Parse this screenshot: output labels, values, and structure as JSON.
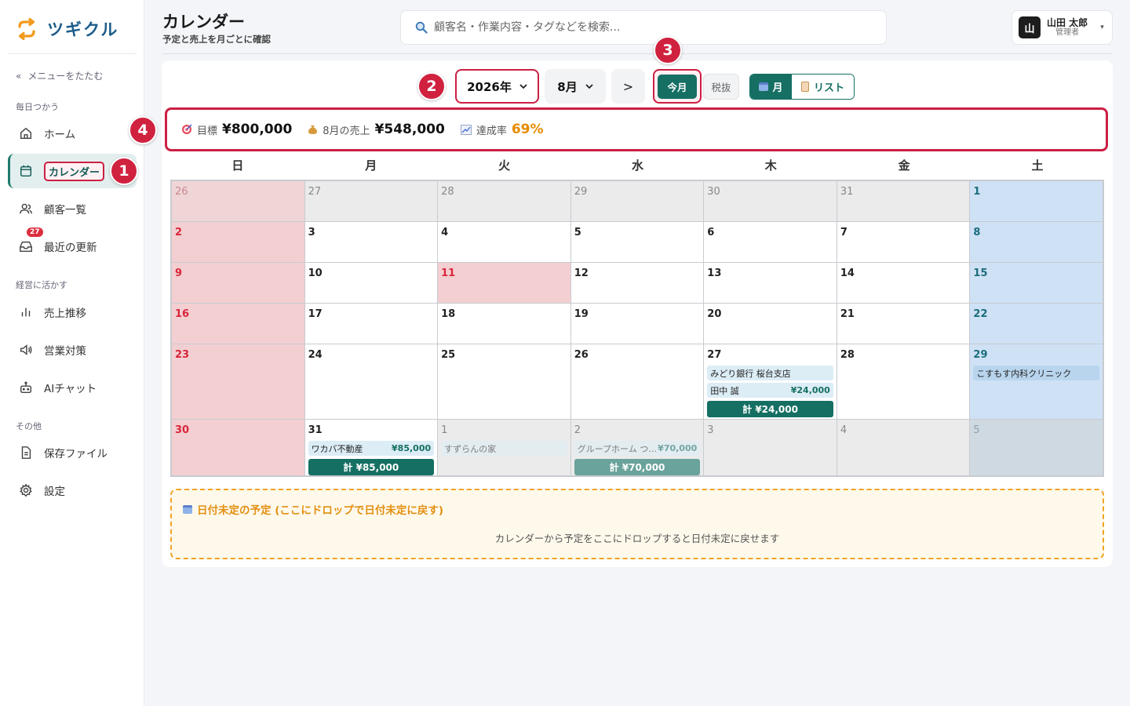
{
  "app": {
    "name": "ツギクル"
  },
  "sidebar": {
    "collapse_label": "メニューをたたむ",
    "collapse_icon": "«",
    "sections": [
      {
        "label": "毎日つかう"
      },
      {
        "label": "経営に活かす"
      },
      {
        "label": "その他"
      }
    ],
    "items": [
      {
        "label": "ホーム",
        "icon": "home-icon"
      },
      {
        "label": "カレンダー",
        "icon": "calendar-icon",
        "active": true
      },
      {
        "label": "顧客一覧",
        "icon": "users-icon"
      },
      {
        "label": "最近の更新",
        "icon": "inbox-icon",
        "badge": "27"
      },
      {
        "label": "売上推移",
        "icon": "bar-chart-icon"
      },
      {
        "label": "営業対策",
        "icon": "megaphone-icon"
      },
      {
        "label": "AIチャット",
        "icon": "robot-icon"
      },
      {
        "label": "保存ファイル",
        "icon": "file-icon"
      },
      {
        "label": "設定",
        "icon": "gear-icon"
      }
    ]
  },
  "header": {
    "title": "カレンダー",
    "subtitle": "予定と売上を月ごとに確認",
    "search_placeholder": "顧客名・作業内容・タグなどを検索...",
    "user_name": "山田 太郎",
    "user_role": "管理者",
    "user_avatar": "山"
  },
  "controls": {
    "year": "2026年",
    "month": "8月",
    "next": ">",
    "today": "今月",
    "tax": "税抜",
    "view_month": "月",
    "view_list": "リスト"
  },
  "summary": {
    "goal_label": "目標",
    "goal_value": "¥800,000",
    "sales_label": "8月の売上",
    "sales_value": "¥548,000",
    "rate_label": "達成率",
    "rate_value": "69%"
  },
  "markers": [
    "1",
    "2",
    "3",
    "4"
  ],
  "calendar": {
    "weekdays": [
      "日",
      "月",
      "火",
      "水",
      "木",
      "金",
      "土"
    ],
    "weeks": [
      [
        {
          "day": "26",
          "out": true
        },
        {
          "day": "27",
          "out": true
        },
        {
          "day": "28",
          "out": true
        },
        {
          "day": "29",
          "out": true
        },
        {
          "day": "30",
          "out": true
        },
        {
          "day": "31",
          "out": true
        },
        {
          "day": "1"
        }
      ],
      [
        {
          "day": "2"
        },
        {
          "day": "3"
        },
        {
          "day": "4"
        },
        {
          "day": "5"
        },
        {
          "day": "6"
        },
        {
          "day": "7"
        },
        {
          "day": "8"
        }
      ],
      [
        {
          "day": "9"
        },
        {
          "day": "10"
        },
        {
          "day": "11",
          "holiday": true
        },
        {
          "day": "12"
        },
        {
          "day": "13"
        },
        {
          "day": "14"
        },
        {
          "day": "15"
        }
      ],
      [
        {
          "day": "16"
        },
        {
          "day": "17"
        },
        {
          "day": "18"
        },
        {
          "day": "19"
        },
        {
          "day": "20"
        },
        {
          "day": "21"
        },
        {
          "day": "22"
        }
      ],
      [
        {
          "day": "23"
        },
        {
          "day": "24"
        },
        {
          "day": "25"
        },
        {
          "day": "26"
        },
        {
          "day": "27",
          "events": [
            {
              "name": "みどり銀行 桜台支店",
              "amount": ""
            },
            {
              "name": "田中 誠",
              "amount": "¥24,000"
            }
          ],
          "total": "計 ¥24,000"
        },
        {
          "day": "28"
        },
        {
          "day": "29",
          "events": [
            {
              "name": "こすもす内科クリニック",
              "amount": ""
            }
          ]
        }
      ],
      [
        {
          "day": "30"
        },
        {
          "day": "31",
          "events": [
            {
              "name": "ワカバ不動産",
              "amount": "¥85,000"
            }
          ],
          "total": "計 ¥85,000"
        },
        {
          "day": "1",
          "out": true,
          "events": [
            {
              "name": "すずらんの家",
              "amount": ""
            }
          ]
        },
        {
          "day": "2",
          "out": true,
          "events": [
            {
              "name": "グループホーム つ…",
              "amount": "¥70,000"
            }
          ],
          "total": "計 ¥70,000"
        },
        {
          "day": "3",
          "out": true
        },
        {
          "day": "4",
          "out": true
        },
        {
          "day": "5",
          "out": true
        }
      ]
    ]
  },
  "undated": {
    "title": "日付未定の予定 (ここにドロップで日付未定に戻す)",
    "message": "カレンダーから予定をここにドロップすると日付未定に戻せます"
  },
  "colors": {
    "accent": "#156f63",
    "marker": "#d0213f",
    "sunday": "#d8263b",
    "saturday": "#1a6e7a",
    "rate": "#e68a00"
  }
}
